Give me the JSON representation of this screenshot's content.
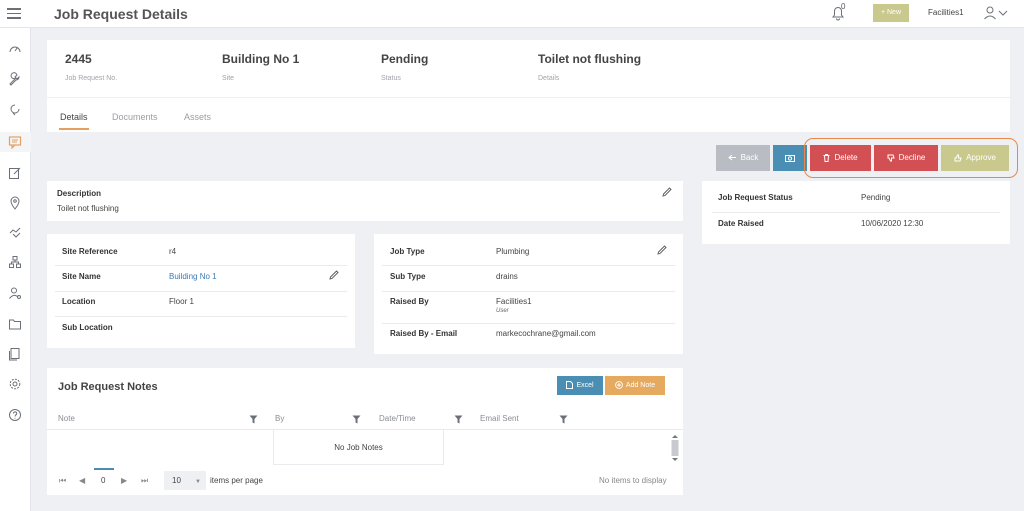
{
  "topbar": {
    "title": "Job Request Details",
    "notification_count": "0",
    "new_button": "+ New",
    "user_name": "Facilities1"
  },
  "sidebar": {
    "items": [
      "dashboard-icon",
      "wrench-icon",
      "refresh-icon",
      "chat-icon",
      "edit-icon",
      "location-icon",
      "handshake-icon",
      "hierarchy-icon",
      "user-search-icon",
      "folder-icon",
      "documents-icon",
      "settings-icon",
      "help-icon"
    ],
    "active_index": 3
  },
  "header": {
    "fields": [
      {
        "value": "2445",
        "label": "Job Request No."
      },
      {
        "value": "Building No 1",
        "label": "Site"
      },
      {
        "value": "Pending",
        "label": "Status"
      },
      {
        "value": "Toilet not flushing",
        "label": "Details"
      }
    ],
    "tabs": [
      "Details",
      "Documents",
      "Assets"
    ],
    "active_tab": "Details"
  },
  "actions": {
    "back": "Back",
    "delete": "Delete",
    "decline": "Decline",
    "approve": "Approve"
  },
  "description": {
    "title": "Description",
    "text": "Toilet not flushing"
  },
  "status_panel": {
    "rows": [
      {
        "label": "Job Request Status",
        "value": "Pending"
      },
      {
        "label": "Date Raised",
        "value": "10/06/2020 12:30"
      }
    ]
  },
  "site_info": {
    "rows": [
      {
        "label": "Site Reference",
        "value": "r4"
      },
      {
        "label": "Site Name",
        "value": "Building No 1"
      },
      {
        "label": "Location",
        "value": "Floor 1"
      },
      {
        "label": "Sub Location",
        "value": ""
      }
    ]
  },
  "job_info": {
    "rows": [
      {
        "label": "Job Type",
        "value": "Plumbing"
      },
      {
        "label": "Sub Type",
        "value": "drains"
      },
      {
        "label": "Raised By",
        "value": "Facilities1",
        "sub": "User"
      },
      {
        "label": "Raised By - Email",
        "value": "markecochrane@gmail.com"
      }
    ]
  },
  "notes": {
    "title": "Job Request Notes",
    "excel": "Excel",
    "add_note": "Add Note",
    "columns": [
      "Note",
      "By",
      "Date/Time",
      "Email Sent"
    ],
    "empty_text": "No Job Notes",
    "pager": {
      "page": "0",
      "page_size": "10",
      "page_size_label": "items per page",
      "status": "No items to display"
    }
  },
  "colors": {
    "accent": "#e5a060",
    "danger": "#d24f54",
    "approve": "#c9c98e",
    "primary": "#4a8fb3"
  }
}
